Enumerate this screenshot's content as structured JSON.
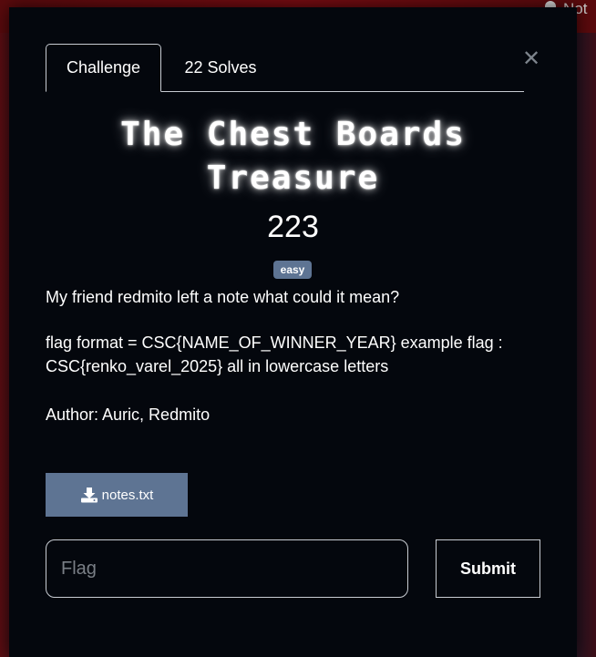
{
  "background": {
    "notification_label": "Not"
  },
  "tabs": [
    {
      "label": "Challenge",
      "active": true
    },
    {
      "label": "22 Solves",
      "active": false
    }
  ],
  "close_icon": "close-icon",
  "challenge": {
    "title": "The Chest Boards Treasure",
    "points": "223",
    "difficulty": "easy",
    "description": [
      "My friend redmito left a note what could it mean?",
      "flag format = CSC{NAME_OF_WINNER_YEAR} example flag : CSC{renko_varel_2025} all in lowercase letters",
      "Author: Auric, Redmito"
    ]
  },
  "file": {
    "name": "notes.txt",
    "icon": "download-icon"
  },
  "flag_form": {
    "placeholder": "Flag",
    "value": "",
    "submit_label": "Submit"
  },
  "colors": {
    "modal_bg": "#04070d",
    "accent": "#5e7493",
    "topbar": "#7a0c12"
  }
}
